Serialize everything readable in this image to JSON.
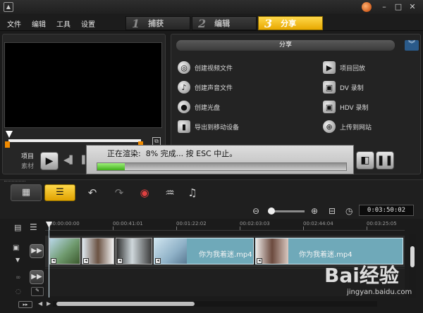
{
  "menu": {
    "items": [
      "文件",
      "编辑",
      "工具",
      "设置"
    ]
  },
  "steps": [
    {
      "num": "1",
      "label": "捕获",
      "active": false
    },
    {
      "num": "2",
      "label": "编辑",
      "active": false
    },
    {
      "num": "3",
      "label": "分享",
      "active": true
    }
  ],
  "window": {
    "minimize": "–",
    "maximize": "□",
    "close": "✕"
  },
  "preview": {
    "mode_project": "项目",
    "mode_clip": "素材"
  },
  "share": {
    "title": "分享",
    "options_left": [
      {
        "label": "创建视频文件",
        "icon": "film-reel-icon"
      },
      {
        "label": "创建声音文件",
        "icon": "sound-disc-icon"
      },
      {
        "label": "创建光盘",
        "icon": "disc-icon"
      },
      {
        "label": "导出到移动设备",
        "icon": "mobile-device-icon"
      }
    ],
    "options_right": [
      {
        "label": "项目回放",
        "icon": "project-playback-icon"
      },
      {
        "label": "DV 录制",
        "icon": "dv-camera-icon"
      },
      {
        "label": "HDV 录制",
        "icon": "hdv-camera-icon"
      },
      {
        "label": "上传到网站",
        "icon": "globe-icon"
      }
    ]
  },
  "render": {
    "message": "正在渲染:  8% 完成... 按 ESC 中止。",
    "progress_fraction": 0.11
  },
  "timeline": {
    "timecode": "0:03:50:02",
    "ticks": [
      "00:00:00:00",
      "00:00:41:01",
      "00:01:22:02",
      "00:02:03:03",
      "00:02:44:04",
      "00:03:25:05"
    ],
    "clips": [
      {
        "name": "你为我着迷.mp4"
      },
      {
        "name": "你为我着迷.mp4"
      }
    ]
  },
  "watermark": {
    "brand": "Bai经验",
    "url": "jingyan.baidu.com"
  },
  "colors": {
    "accent": "#f2b400",
    "progress": "#5cc934",
    "clip": "#6fa9b9"
  }
}
